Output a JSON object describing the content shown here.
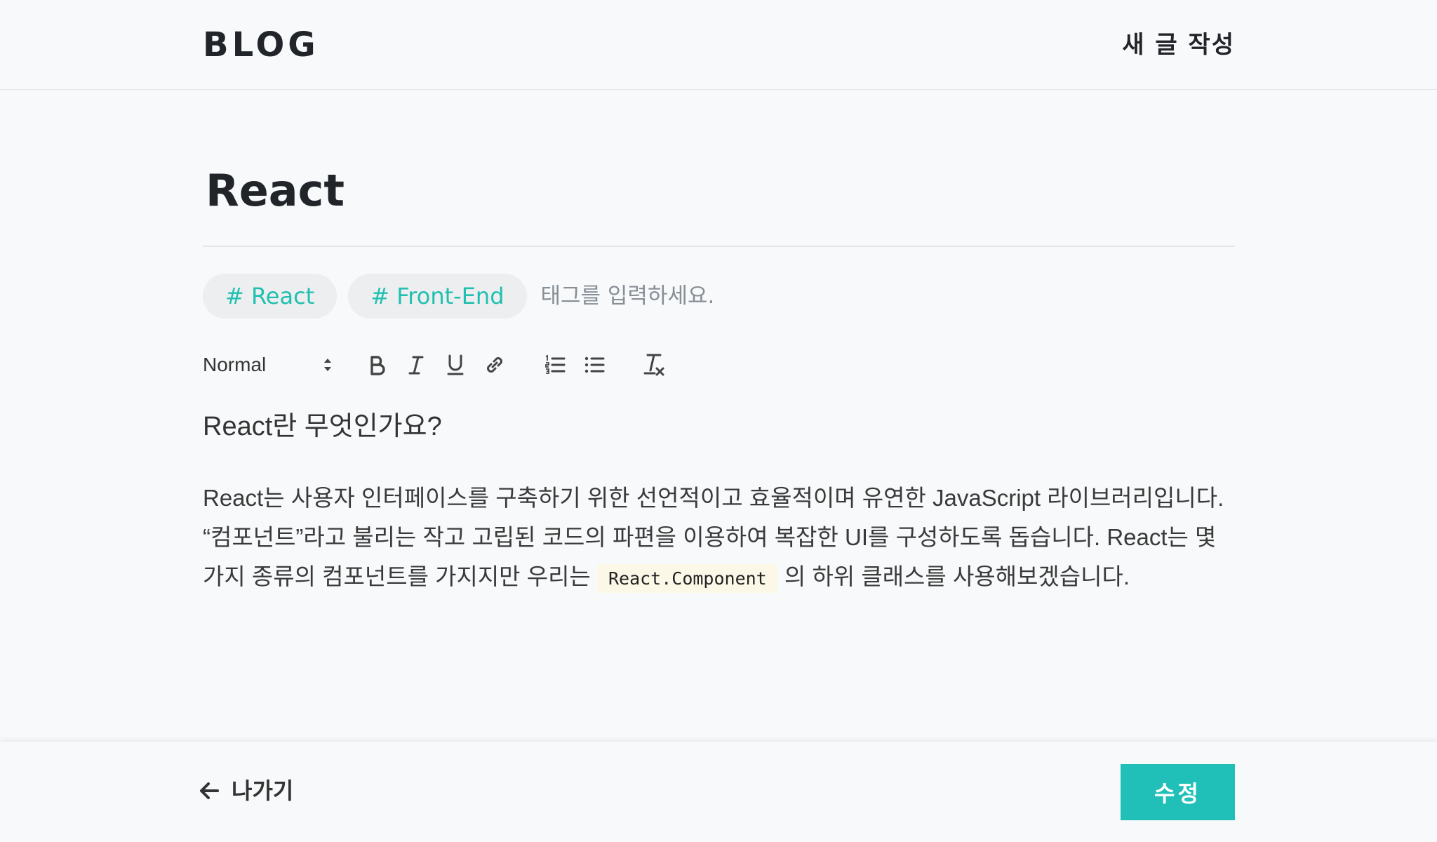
{
  "header": {
    "logo": "BLOG",
    "new_post": "새 글 작성"
  },
  "post": {
    "title": "React"
  },
  "tags": {
    "items": [
      "# React",
      "# Front-End"
    ],
    "input_placeholder": "태그를 입력하세요."
  },
  "toolbar": {
    "format_value": "Normal",
    "icons": [
      "bold-icon",
      "italic-icon",
      "underline-icon",
      "link-icon",
      "ordered-list-icon",
      "bullet-list-icon",
      "clear-format-icon"
    ]
  },
  "editor": {
    "heading": "React란 무엇인가요?",
    "paragraph_part1": "React는 사용자 인터페이스를 구축하기 위한 선언적이고 효율적이며 유연한 JavaScript 라이브러리입니다. “컴포넌트”라고 불리는 작고 고립된 코드의 파편을 이용하여 복잡한 UI를 구성하도록 돕습니다. React는 몇 가지 종류의 컴포넌트를 가지지만 우리는 ",
    "code": "React.Component",
    "paragraph_part2": " 의 하위 클래스를 사용해보겠습니다."
  },
  "footer": {
    "back_label": "나가기",
    "submit_label": "수정"
  },
  "colors": {
    "accent": "#20c0b8",
    "tag_text": "#20c0b0",
    "tag_bg": "#eceeef",
    "background": "#f8f9fa",
    "code_bg": "#fbf8e8"
  }
}
